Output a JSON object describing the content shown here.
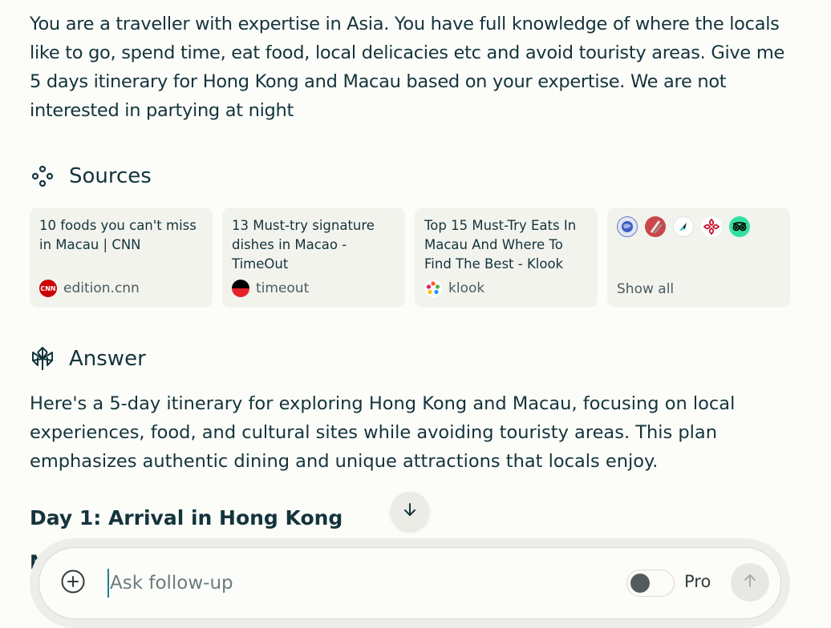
{
  "query": {
    "text": "You are a traveller with expertise in Asia. You have full knowledge of where the locals like to go, spend time, eat food, local delicacies etc and avoid touristy areas. Give me 5 days itinerary for Hong Kong and Macau based on your expertise. We are not interested in partying at night"
  },
  "sources": {
    "heading": "Sources",
    "icon": "sources-icon",
    "cards": [
      {
        "title": "10 foods you can't miss in Macau | CNN",
        "site": "edition.cnn",
        "favicon": "cnn-icon",
        "favicon_text": "CNN"
      },
      {
        "title": "13 Must-try signature dishes in Macao - TimeOut",
        "site": "timeout",
        "favicon": "timeout-icon"
      },
      {
        "title": "Top 15 Must-Try Eats In Macau And Where To Find The Best - Klook",
        "site": "klook",
        "favicon": "klook-icon"
      }
    ],
    "show_all_label": "Show all",
    "show_all_favicons": [
      "globe-icon",
      "red-leaf-icon",
      "blue-arrow-icon",
      "red-flower-icon",
      "tripadvisor-icon"
    ]
  },
  "answer": {
    "heading": "Answer",
    "icon": "perplexity-icon",
    "intro": "Here's a 5-day itinerary for exploring Hong Kong and Macau, focusing on local experiences, food, and cultural sites while avoiding touristy areas. This plan emphasizes authentic dining and unique attractions that locals enjoy.",
    "day1_heading": "Day 1: Arrival in Hong Kong",
    "clipped_line": "M"
  },
  "followup": {
    "placeholder": "Ask follow-up",
    "value": "",
    "pro_label": "Pro",
    "pro_enabled": false
  },
  "colors": {
    "background": "#fcfcf9",
    "text": "#13343b",
    "card_bg": "#f3f3ee",
    "accent": "#20808d"
  }
}
